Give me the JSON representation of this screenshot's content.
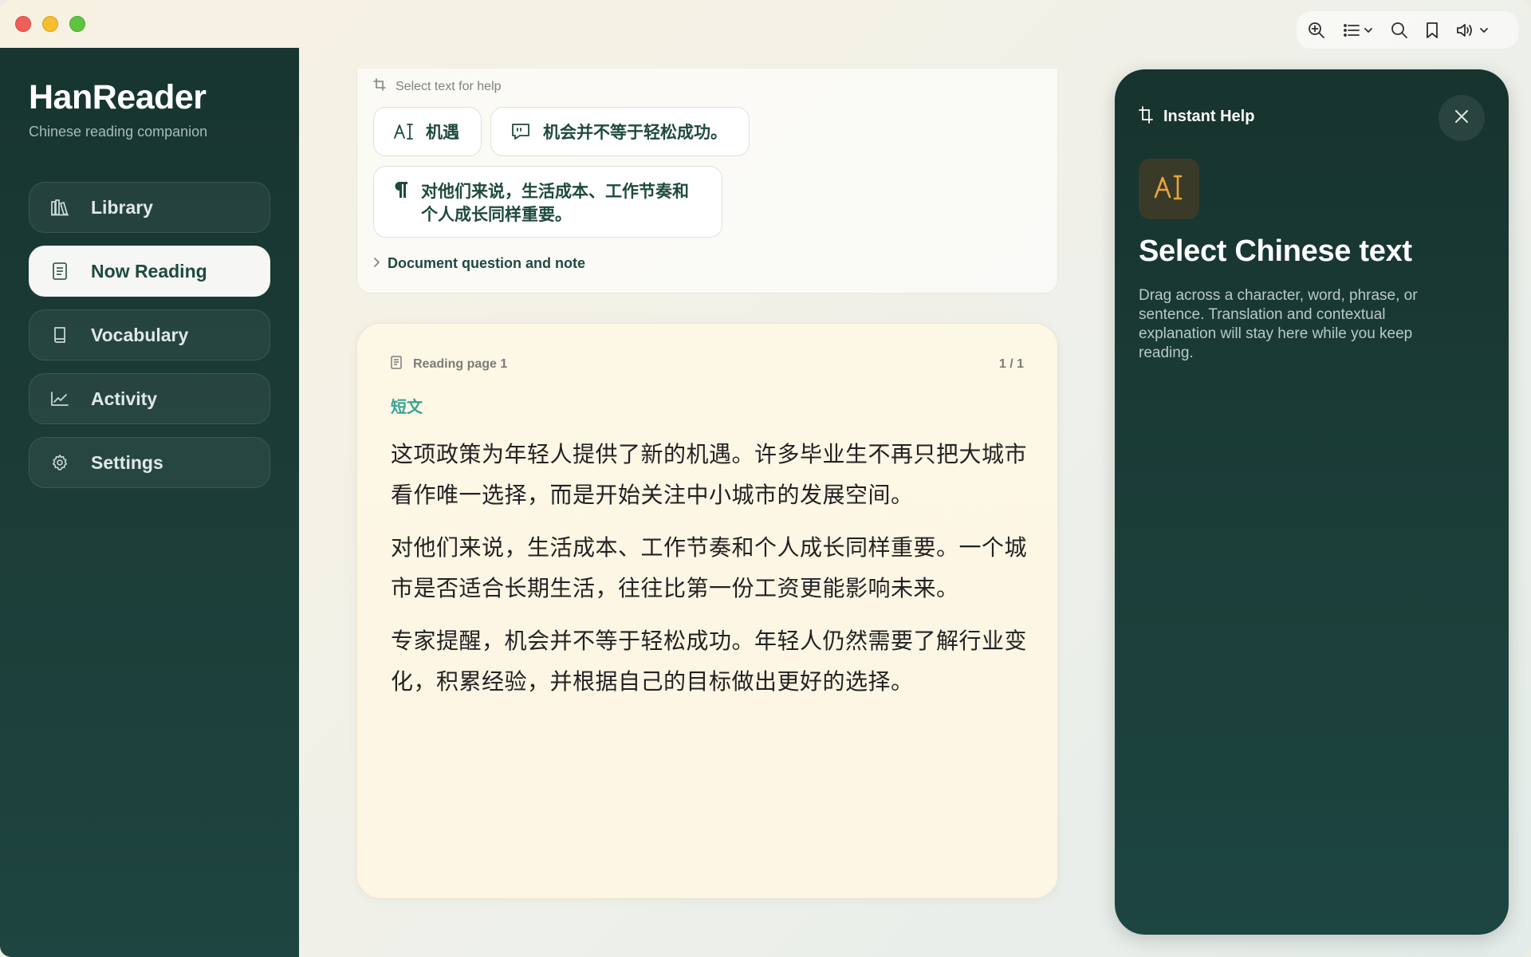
{
  "app": {
    "name": "HanReader",
    "subtitle": "Chinese reading companion"
  },
  "window_controls": [
    "close",
    "minimize",
    "maximize"
  ],
  "sidebar": {
    "items": [
      {
        "label": "Library",
        "icon": "books-icon",
        "active": false
      },
      {
        "label": "Now Reading",
        "icon": "document-icon",
        "active": true
      },
      {
        "label": "Vocabulary",
        "icon": "book-icon",
        "active": false
      },
      {
        "label": "Activity",
        "icon": "chart-icon",
        "active": false
      },
      {
        "label": "Settings",
        "icon": "gear-icon",
        "active": false
      }
    ]
  },
  "toolbar": {
    "buttons": [
      "zoom-in-icon",
      "list-icon",
      "search-icon",
      "bookmark-icon",
      "speaker-icon"
    ]
  },
  "help_card": {
    "header": "Select text for help",
    "word_chip": "机遇",
    "sentence_chip": "机会并不等于轻松成功。",
    "paragraph_chip": "对他们来说，生活成本、工作节奏和个人成长同样重要。",
    "note_toggle": "Document question and note"
  },
  "reading": {
    "page_label": "Reading page 1",
    "counter": "1 / 1",
    "tag": "短文",
    "paragraphs": [
      "这项政策为年轻人提供了新的机遇。许多毕业生不再只把大城市看作唯一选择，而是开始关注中小城市的发展空间。",
      "对他们来说，生活成本、工作节奏和个人成长同样重要。一个城市是否适合长期生活，往往比第一份工资更能影响未来。",
      "专家提醒，机会并不等于轻松成功。年轻人仍然需要了解行业变化，积累经验，并根据自己的目标做出更好的选择。"
    ]
  },
  "instant_help": {
    "header": "Instant Help",
    "title": "Select Chinese text",
    "description": "Drag across a character, word, phrase, or sentence. Translation and contextual explanation will stay here while you keep reading."
  },
  "colors": {
    "sidebar_bg": "#183530",
    "accent_teal": "#3aa394",
    "accent_text": "#1f4a3f",
    "badge_gold": "#e8a53a"
  }
}
